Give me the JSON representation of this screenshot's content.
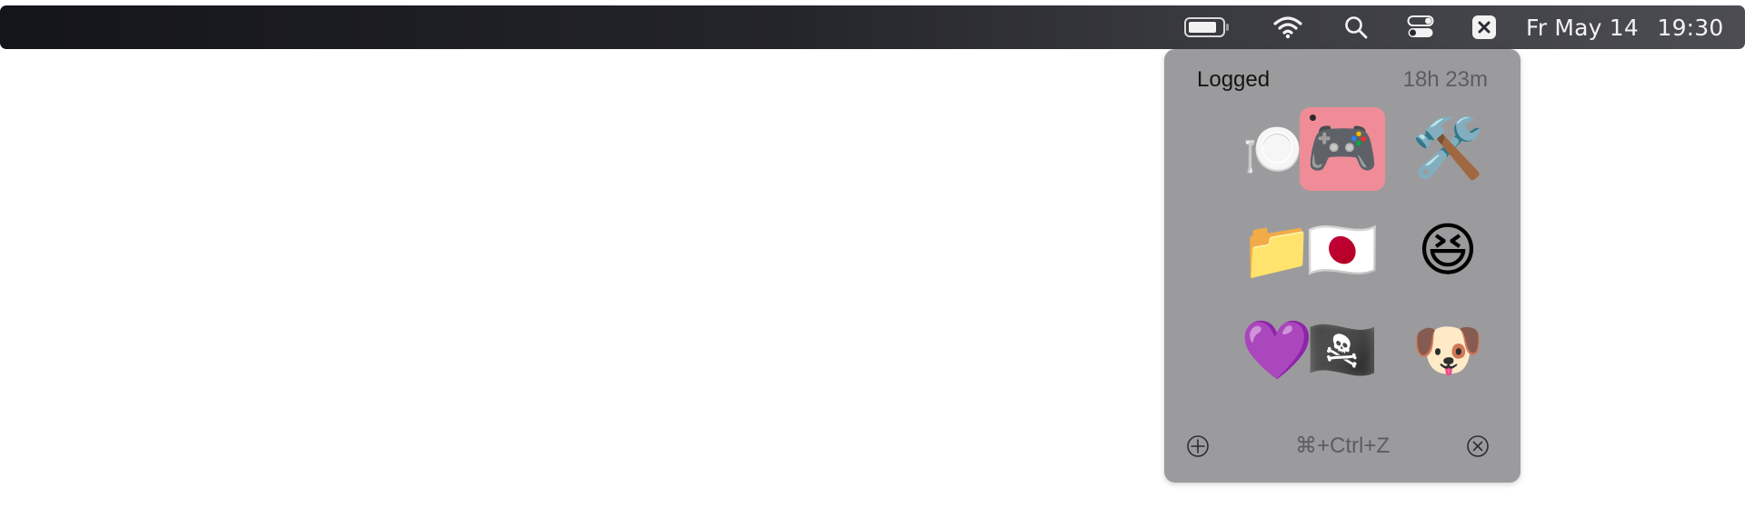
{
  "menubar": {
    "date": "Fr May 14",
    "time": "19:30"
  },
  "popover": {
    "title": "Logged",
    "duration": "18h 23m",
    "shortcut": "⌘+Ctrl+Z",
    "grid": [
      {
        "emoji": "🍽️",
        "name": "fork-and-knife-with-plate"
      },
      {
        "emoji": "🎮",
        "name": "video-game-controller",
        "selected": true
      },
      {
        "emoji": "🛠️",
        "name": "hammer-and-wrench"
      },
      {
        "emoji": "📁",
        "name": "file-folder"
      },
      {
        "emoji": "🇯🇵",
        "name": "flag-japan"
      },
      {
        "emoji": "😆",
        "name": "grinning-squinting-face"
      },
      {
        "emoji": "💜",
        "name": "purple-heart"
      },
      {
        "emoji": "🏴‍☠️",
        "name": "pirate-flag"
      },
      {
        "emoji": "🐶",
        "name": "dog-face"
      }
    ]
  },
  "colors": {
    "popover_bg": "#9b9b9d",
    "selected_bg": "#f08c98",
    "menubar_bg": "#14151a"
  }
}
